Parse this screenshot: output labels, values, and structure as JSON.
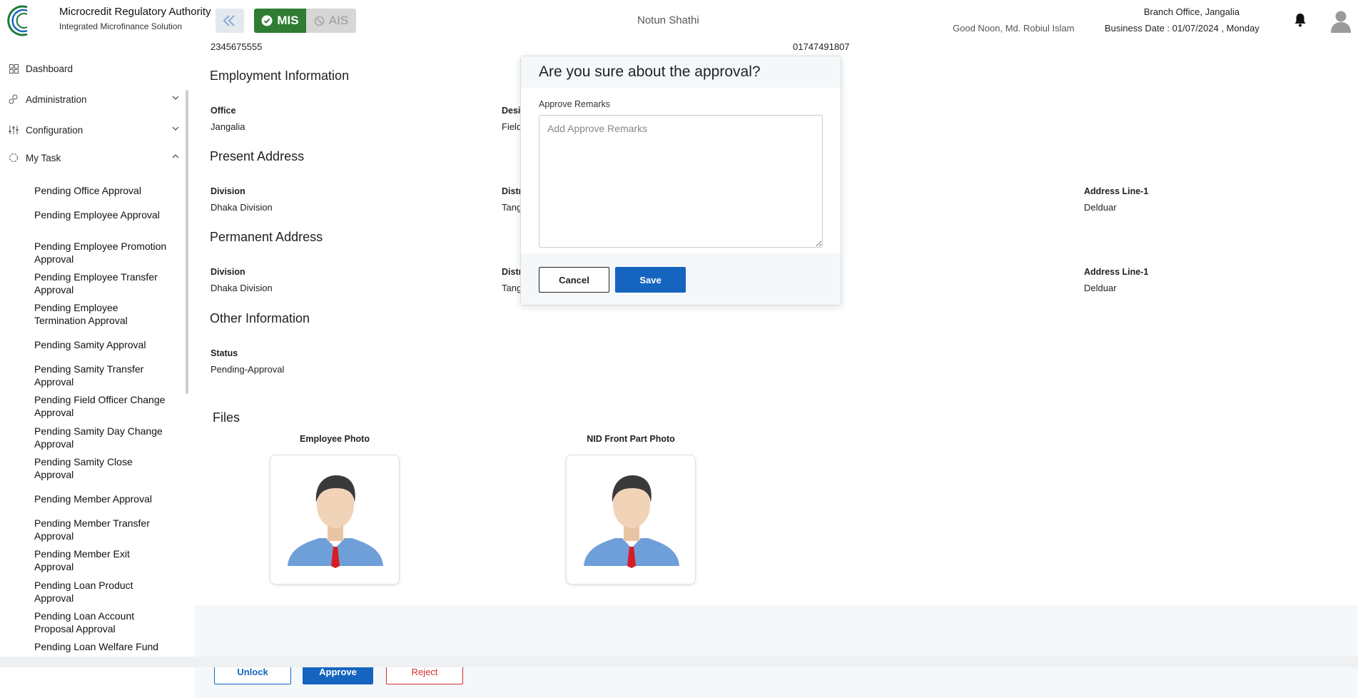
{
  "header": {
    "brand_title": "Microcredit Regulatory Authority",
    "brand_sub": "Integrated Microfinance Solution",
    "logo_text": "Microcredit Regulatory Authority",
    "mis_label": "MIS",
    "ais_label": "AIS",
    "app_name": "Notun Shathi",
    "greeting": "Good Noon, Md. Robiul Islam",
    "branch": "Branch Office, Jangalia",
    "business_date": "Business Date : 01/07/2024 , Monday"
  },
  "sidebar": {
    "top_items": [
      {
        "label": "Dashboard",
        "icon": "grid-icon"
      },
      {
        "label": "Administration",
        "icon": "admin-icon"
      },
      {
        "label": "Configuration",
        "icon": "sliders-icon"
      },
      {
        "label": "My Task",
        "icon": "task-icon"
      }
    ],
    "sub_items": [
      "Pending Office Approval",
      "Pending Employee Approval",
      "Pending Employee Promotion Approval",
      "Pending Employee Transfer Approval",
      "Pending Employee Termination Approval",
      "Pending Samity Approval",
      "Pending Samity Transfer Approval",
      "Pending Field Officer Change Approval",
      "Pending Samity Day Change Approval",
      "Pending Samity Close Approval",
      "Pending Member Approval",
      "Pending Member Transfer Approval",
      "Pending Member Exit Approval",
      "Pending Loan Product Approval",
      "Pending Loan Account Proposal Approval",
      "Pending Loan Welfare Fund Approval"
    ]
  },
  "main": {
    "top_value_left": "2345675555",
    "top_value_right": "01747491807",
    "employment": {
      "title": "Employment Information",
      "office_label": "Office",
      "office_value": "Jangalia",
      "designation_label": "Desig",
      "designation_value": "Field"
    },
    "present": {
      "title": "Present Address",
      "division_label": "Division",
      "division_value": "Dhaka Division",
      "district_label": "Distr",
      "district_value": "Tang",
      "address_label": "Address Line-1",
      "address_value": "Delduar"
    },
    "permanent": {
      "title": "Permanent Address",
      "division_label": "Division",
      "division_value": "Dhaka Division",
      "district_label": "Distr",
      "district_value": "Tang",
      "address_label": "Address Line-1",
      "address_value": "Delduar"
    },
    "other": {
      "title": "Other Information",
      "status_label": "Status",
      "status_value": "Pending-Approval"
    },
    "files": {
      "title": "Files",
      "employee_photo_label": "Employee Photo",
      "nid_photo_label": "NID Front Part Photo"
    },
    "actions": {
      "unlock": "Unlock",
      "approve": "Approve",
      "reject": "Reject"
    }
  },
  "modal": {
    "title": "Are you sure about the approval?",
    "remarks_label": "Approve Remarks",
    "remarks_placeholder": "Add Approve Remarks",
    "remarks_value": "",
    "cancel": "Cancel",
    "save": "Save"
  },
  "colors": {
    "primary": "#1565c0",
    "mis_green": "#2e7d32",
    "danger": "#d32f2f"
  }
}
